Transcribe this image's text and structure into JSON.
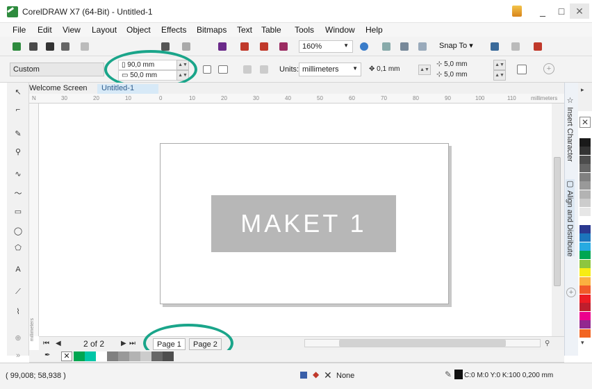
{
  "window": {
    "title": "CorelDRAW X7 (64-Bit) - Untitled-1",
    "minimize": "_",
    "maximize": "□",
    "close": "✕"
  },
  "menu": [
    "File",
    "Edit",
    "View",
    "Layout",
    "Object",
    "Effects",
    "Bitmaps",
    "Text",
    "Table",
    "Tools",
    "Window",
    "Help"
  ],
  "toolbar": {
    "zoom": "160%",
    "snap_label": "Snap To"
  },
  "propbar": {
    "preset": "Custom",
    "width": "90,0 mm",
    "height": "50,0 mm",
    "units_label": "Units:",
    "units": "millimeters",
    "nudge": "0,1 mm",
    "dup_x": "5,0 mm",
    "dup_y": "5,0 mm"
  },
  "doc_tabs": {
    "welcome": "Welcome Screen",
    "active": "Untitled-1"
  },
  "ruler": {
    "unit": "millimeters",
    "origin": "N",
    "ticks": [
      "30",
      "20",
      "10",
      "0",
      "10",
      "20",
      "30",
      "40",
      "50",
      "60",
      "70",
      "80",
      "90",
      "100",
      "110"
    ]
  },
  "canvas": {
    "object_text": "MAKET 1"
  },
  "dockers": {
    "insert_character": "Insert Character",
    "align_distribute": "Align and Distribute"
  },
  "page_nav": {
    "count": "2 of 2",
    "pages": [
      "Page 1",
      "Page 2"
    ]
  },
  "status": {
    "coords": "( 99,008; 58,938 )",
    "fill": "None",
    "outline": "C:0 M:0 Y:0 K:100  0,200 mm"
  },
  "colors": {
    "highlight": "#1aa58a",
    "palette": [
      "#ffffff",
      "#1a1a1a",
      "#333333",
      "#4d4d4d",
      "#666666",
      "#808080",
      "#999999",
      "#b3b3b3",
      "#cccccc",
      "#e6e6e6",
      "#ffffff",
      "#2b3990",
      "#1c75bc",
      "#27aae1",
      "#00a651",
      "#8dc63f",
      "#f7ec13",
      "#fbb040",
      "#f15a29",
      "#ed1c24",
      "#be1e2d",
      "#ec008c",
      "#92278f",
      "#f26522"
    ],
    "document_colors": [
      "#00a651",
      "#00c6a7",
      "#ffffff",
      "#808080",
      "#999999",
      "#b3b3b3",
      "#cccccc",
      "#666666",
      "#4d4d4d"
    ]
  }
}
